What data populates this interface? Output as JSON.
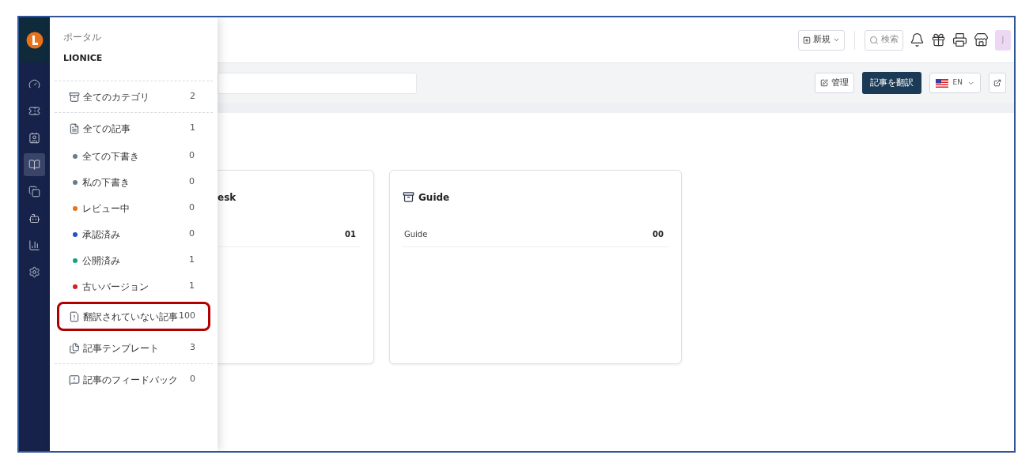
{
  "rail": {
    "items": [
      {
        "kind": "gauge",
        "selected": false
      },
      {
        "kind": "ticket",
        "selected": false
      },
      {
        "kind": "contact",
        "selected": false
      },
      {
        "kind": "book",
        "selected": true
      },
      {
        "kind": "chat",
        "selected": false
      },
      {
        "kind": "bot",
        "selected": false
      },
      {
        "kind": "chart",
        "selected": false
      },
      {
        "kind": "settings",
        "selected": false
      }
    ]
  },
  "drawer": {
    "subtitle": "ポータル",
    "title": "LIONICE",
    "groups": [
      [
        {
          "kind": "categories",
          "label": "全てのカテゴリ",
          "count": "2",
          "highlighted": false
        }
      ],
      [
        {
          "kind": "articles",
          "label": "全ての記事",
          "count": "1",
          "highlighted": false
        },
        {
          "kind": "status",
          "label": "全ての下書き",
          "count": "0",
          "color": "#6b7a90"
        },
        {
          "kind": "status",
          "label": "私の下書き",
          "count": "0",
          "color": "#6b7a90"
        },
        {
          "kind": "status",
          "label": "レビュー中",
          "count": "0",
          "color": "#e8711c"
        },
        {
          "kind": "status",
          "label": "承認済み",
          "count": "0",
          "color": "#2450c8"
        },
        {
          "kind": "status",
          "label": "公開済み",
          "count": "1",
          "color": "#10a37f"
        },
        {
          "kind": "status",
          "label": "古いバージョン",
          "count": "1",
          "color": "#d32020"
        },
        {
          "kind": "untranslated",
          "label": "翻訳されていない記事",
          "count": "100",
          "highlighted": true
        },
        {
          "kind": "templates",
          "label": "記事テンプレート",
          "count": "3",
          "highlighted": false
        }
      ],
      [
        {
          "kind": "feedback",
          "label": "記事のフィードバック",
          "count": "0",
          "highlighted": false
        }
      ]
    ]
  },
  "topbar": {
    "new_button": "新規",
    "search_button": "検索",
    "avatar": "J"
  },
  "toolbar": {
    "manage_button": "管理",
    "translate_button": "記事を翻訳",
    "language": "EN"
  },
  "cards": [
    {
      "title": "esk",
      "rows": [
        {
          "value": "01"
        }
      ]
    },
    {
      "title": "Guide",
      "rows": [
        {
          "label": "Guide",
          "value": "00"
        }
      ]
    }
  ]
}
